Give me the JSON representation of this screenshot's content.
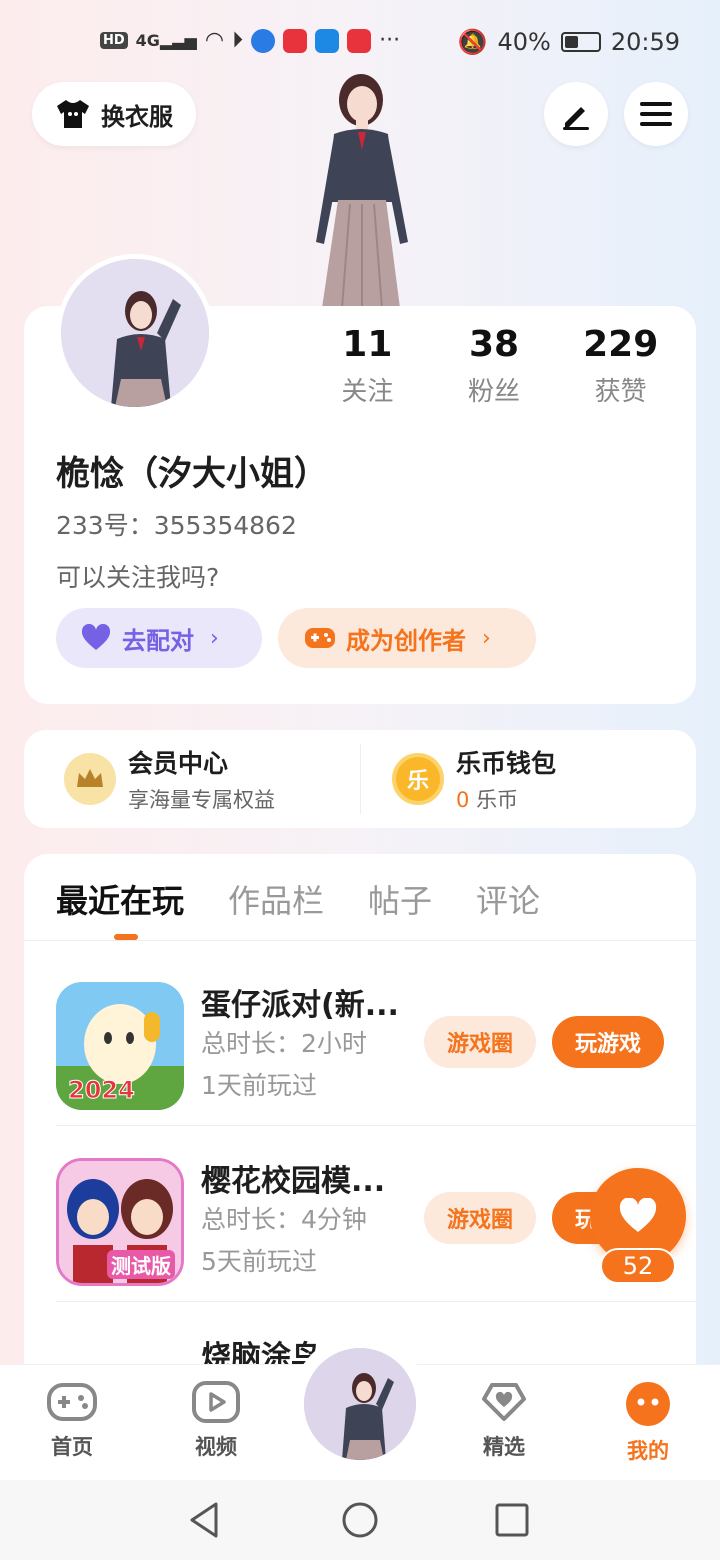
{
  "status_bar": {
    "network": "4G",
    "hd": "HD",
    "more": "···",
    "battery": "40%",
    "battery_level": 0.4,
    "time": "20:59"
  },
  "header": {
    "outfit_label": "换衣服",
    "edit_icon": "pen-icon",
    "menu_icon": "hamburger-icon"
  },
  "profile": {
    "stats": [
      {
        "value": "11",
        "label": "关注"
      },
      {
        "value": "38",
        "label": "粉丝"
      },
      {
        "value": "229",
        "label": "获赞"
      }
    ],
    "nickname": "桅惗（汐大小姐）",
    "uid": "233号：355354862",
    "bio": "可以关注我吗?",
    "match_label": "去配对",
    "creator_label": "成为创作者",
    "chevron": "›"
  },
  "wallet": {
    "vip_title": "会员中心",
    "vip_sub": "享海量专属权益",
    "coin_title": "乐币钱包",
    "coin_icon_text": "乐",
    "coin_amount": "0",
    "coin_unit": "乐币"
  },
  "tabs": [
    "最近在玩",
    "作品栏",
    "帖子",
    "评论"
  ],
  "games": [
    {
      "name": "蛋仔派对(新...",
      "duration": "总时长：2小时",
      "last_played": "1天前玩过",
      "circle_label": "游戏圈",
      "play_label": "玩游戏",
      "badge": "2024"
    },
    {
      "name": "樱花校园模...",
      "duration": "总时长：4分钟",
      "last_played": "5天前玩过",
      "circle_label": "游戏圈",
      "play_label": "玩游戏",
      "badge": "测试版"
    },
    {
      "name": "烧脑涂鸟",
      "duration": "",
      "last_played": "",
      "circle_label": "",
      "play_label": ""
    }
  ],
  "like": {
    "count": "52"
  },
  "bottom_nav": [
    {
      "label": "首页",
      "icon": "gamepad-icon"
    },
    {
      "label": "视频",
      "icon": "video-icon"
    },
    {
      "label": "精选",
      "icon": "heart-diamond-icon"
    },
    {
      "label": "我的",
      "icon": "face-icon"
    }
  ],
  "colors": {
    "accent": "#f4731c",
    "purple": "#7461e3"
  }
}
